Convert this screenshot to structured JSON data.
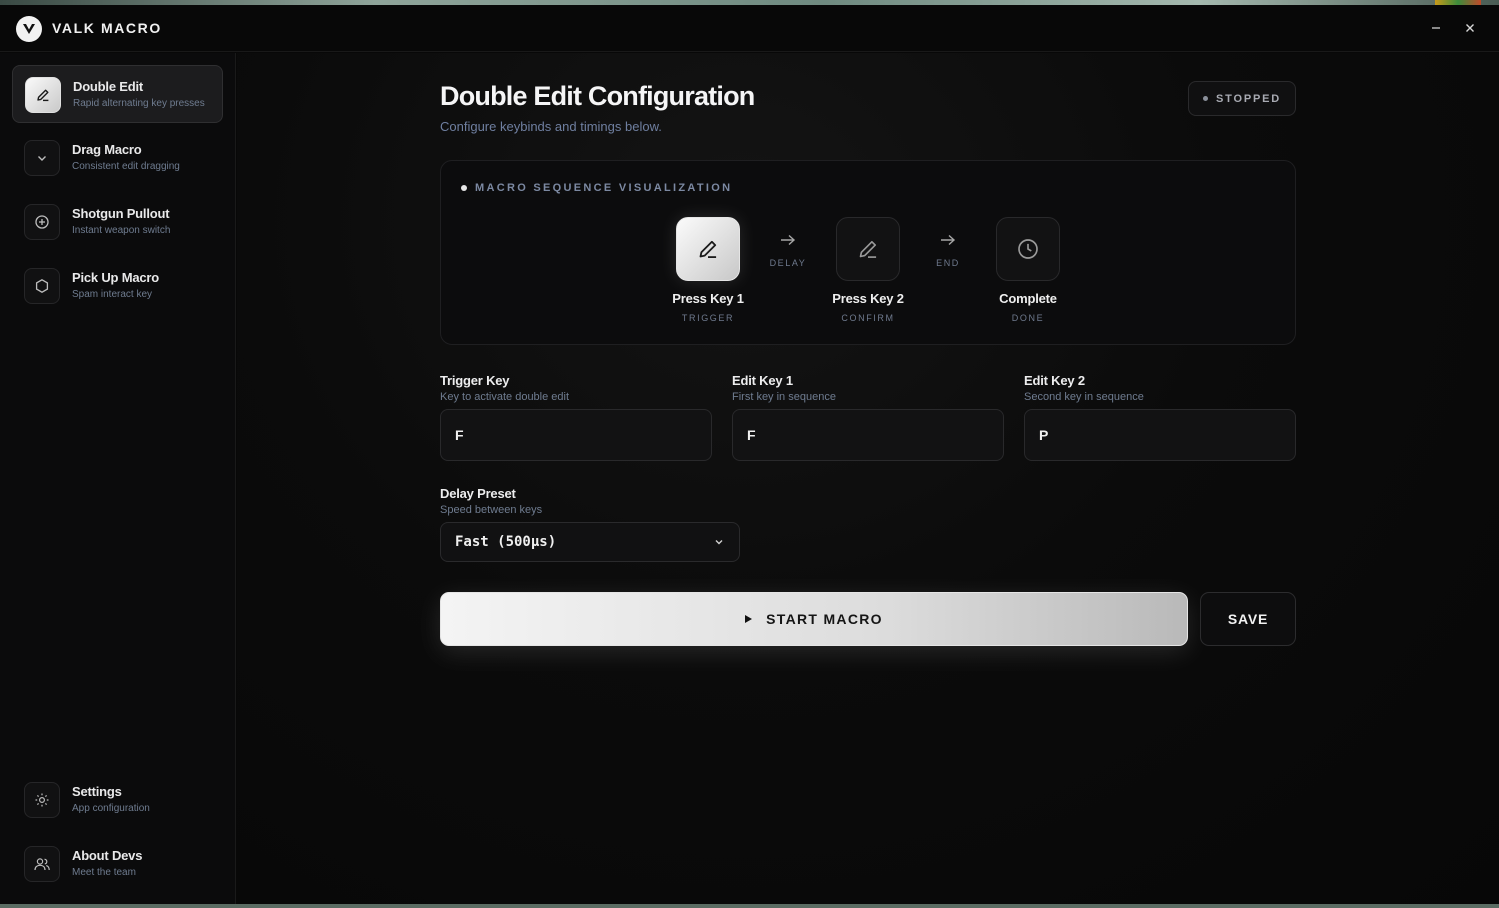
{
  "app": {
    "title": "VALK MACRO"
  },
  "sidebar": {
    "items": [
      {
        "title": "Double Edit",
        "subtitle": "Rapid alternating key presses",
        "icon": "pencil-icon",
        "active": true
      },
      {
        "title": "Drag Macro",
        "subtitle": "Consistent edit dragging",
        "icon": "chevron-down-icon"
      },
      {
        "title": "Shotgun Pullout",
        "subtitle": "Instant weapon switch",
        "icon": "plus-circle-icon"
      },
      {
        "title": "Pick Up Macro",
        "subtitle": "Spam interact key",
        "icon": "hexagon-icon"
      }
    ],
    "bottom": [
      {
        "title": "Settings",
        "subtitle": "App configuration",
        "icon": "gear-icon"
      },
      {
        "title": "About Devs",
        "subtitle": "Meet the team",
        "icon": "users-icon"
      }
    ]
  },
  "main": {
    "title": "Double Edit Configuration",
    "subtitle": "Configure keybinds and timings below.",
    "status": "STOPPED",
    "visualization": {
      "label": "MACRO SEQUENCE VISUALIZATION",
      "steps": [
        {
          "title": "Press Key 1",
          "sub": "TRIGGER",
          "icon": "pencil-icon",
          "active": true
        },
        {
          "title": "Press Key 2",
          "sub": "CONFIRM",
          "icon": "pencil-icon"
        },
        {
          "title": "Complete",
          "sub": "DONE",
          "icon": "clock-icon"
        }
      ],
      "connectors": [
        "DELAY",
        "END"
      ]
    },
    "fields": [
      {
        "label": "Trigger Key",
        "help": "Key to activate double edit",
        "value": "F"
      },
      {
        "label": "Edit Key 1",
        "help": "First key in sequence",
        "value": "F"
      },
      {
        "label": "Edit Key 2",
        "help": "Second key in sequence",
        "value": "P"
      }
    ],
    "delay": {
      "label": "Delay Preset",
      "help": "Speed between keys",
      "value": "Fast (500µs)"
    },
    "start_label": "START MACRO",
    "save_label": "SAVE"
  },
  "colors": {
    "accent": "#f2f2f2",
    "background": "#080808",
    "muted": "#6f7c90"
  }
}
